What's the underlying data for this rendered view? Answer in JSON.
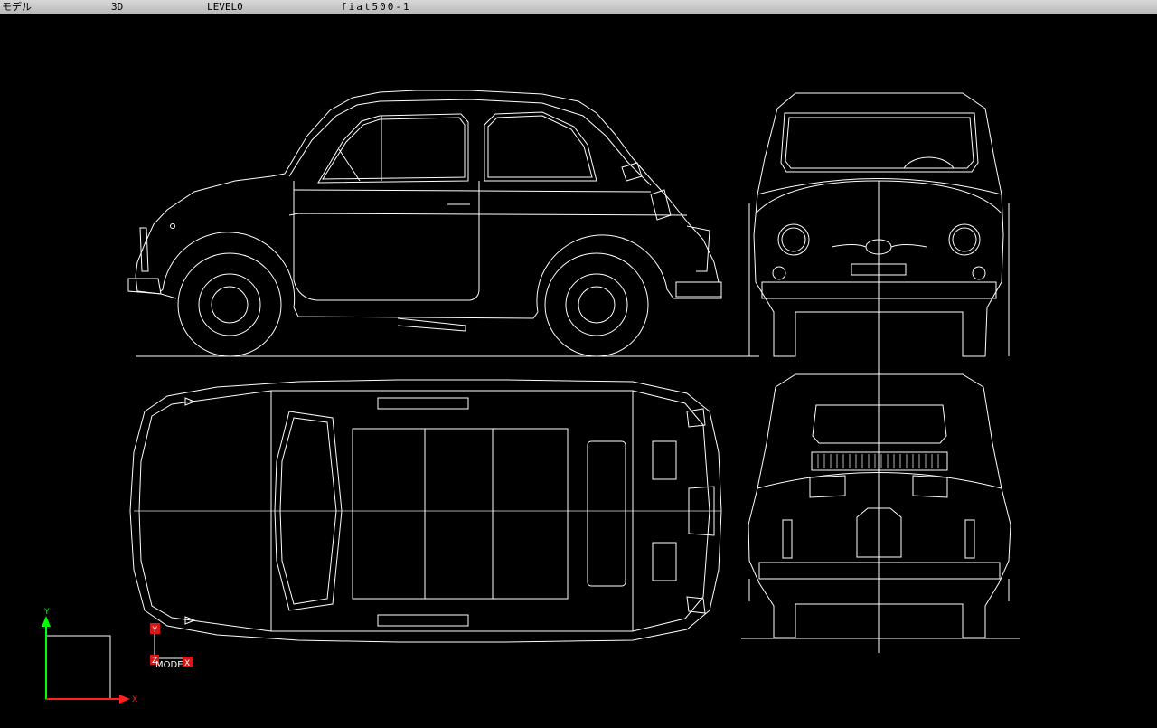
{
  "statusbar": {
    "mode": "モデル",
    "view": "3D",
    "level": "LEVEL0",
    "file": "fiat500-1"
  },
  "ucs": {
    "y_label": "Y",
    "x_label": "X",
    "z_label": "Z",
    "model_label": "MODEL",
    "y_color": "#00ff00",
    "x_color": "#ff2020",
    "box_color": "#ffffff"
  }
}
